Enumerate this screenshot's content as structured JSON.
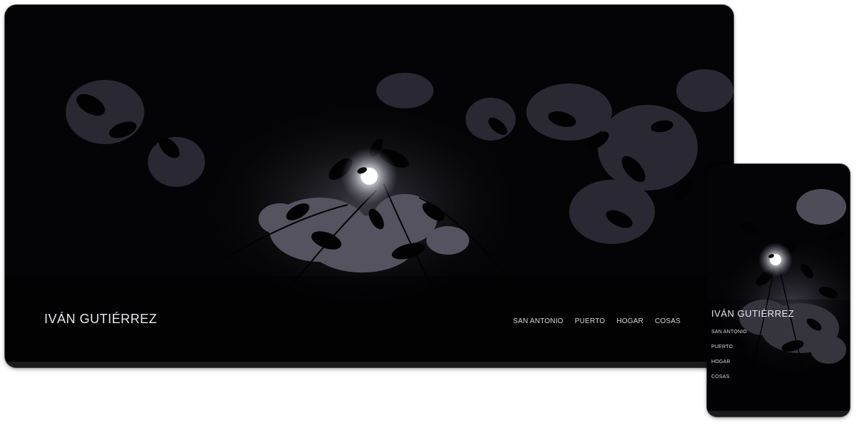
{
  "site": {
    "title": "IVÁN GUTIÉRREZ"
  },
  "nav": {
    "items": [
      {
        "label": "SAN ANTONIO"
      },
      {
        "label": "PUERTO"
      },
      {
        "label": "HOGAR"
      },
      {
        "label": "COSAS"
      }
    ]
  },
  "hero": {
    "image": "night-moon-through-leaves",
    "sky_color": "#5c5a68",
    "moon_color": "#ffffff"
  }
}
